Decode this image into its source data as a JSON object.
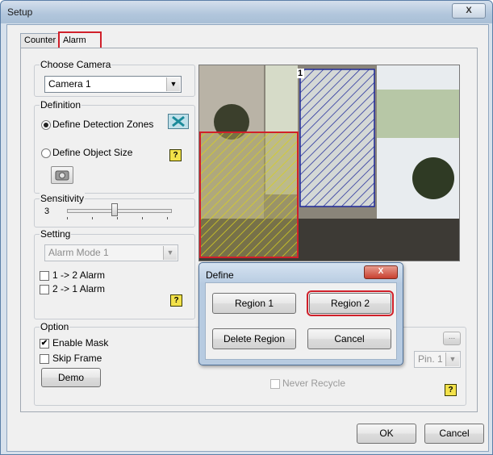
{
  "window": {
    "title": "Setup"
  },
  "tabs": {
    "counter": "Counter",
    "alarm": "Alarm"
  },
  "choose_camera": {
    "legend": "Choose Camera",
    "selected": "Camera 1"
  },
  "definition": {
    "legend": "Definition",
    "zones_label": "Define Detection Zones",
    "object_size_label": "Define Object Size"
  },
  "sensitivity": {
    "legend": "Sensitivity",
    "value_label": "3",
    "level_fraction": 0.45
  },
  "setting": {
    "legend": "Setting",
    "mode": "Alarm Mode 1",
    "alarm_1_2": "1 -> 2 Alarm",
    "alarm_2_1": "2 -> 1 Alarm"
  },
  "option": {
    "legend": "Option",
    "enable_mask": "Enable Mask",
    "skip_frame": "Skip Frame",
    "demo": "Demo",
    "never_recycle": "Never Recycle",
    "pin": "Pin. 1",
    "ellipsis": "..."
  },
  "video": {
    "region_label": "1"
  },
  "define_dialog": {
    "title": "Define",
    "close": "X",
    "region1": "Region 1",
    "region2": "Region 2",
    "delete_region": "Delete Region",
    "cancel": "Cancel"
  },
  "footer": {
    "ok": "OK",
    "cancel": "Cancel"
  },
  "icons": {
    "close": "X",
    "help": "?",
    "arrow": "▼",
    "check": "✔"
  },
  "colors": {
    "region_red": "#d0202a",
    "region_blue": "#1f2a9a",
    "hatch_yellow": "#d8d020",
    "help_yellow": "#f3e24a"
  }
}
